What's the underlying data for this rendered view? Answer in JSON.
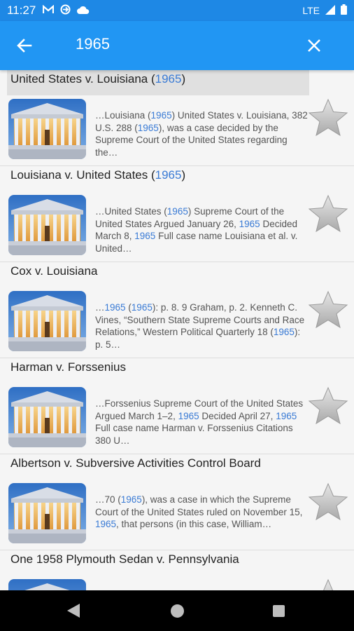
{
  "status_bar": {
    "time": "11:27",
    "icons": [
      "gmail-icon",
      "sync-icon",
      "cloud-icon"
    ],
    "network": "LTE"
  },
  "app_bar": {
    "search_value": "1965",
    "back_icon": "arrow-back-icon",
    "close_icon": "close-icon"
  },
  "colors": {
    "status_bar": "#1e88e5",
    "app_bar": "#2196f3",
    "link": "#3a7bd5"
  },
  "results": [
    {
      "title_pre": "United States v. Louisiana (",
      "title_year": "1965",
      "title_post": ")",
      "highlight": true,
      "snippet": [
        {
          "t": "…Louisiana ("
        },
        {
          "t": "1965",
          "y": true
        },
        {
          "t": ") United States v. Louisiana, 382 U.S. 288 ("
        },
        {
          "t": "1965",
          "y": true
        },
        {
          "t": "), was a case decided by the Supreme Court of the United States regarding the…"
        }
      ]
    },
    {
      "title_pre": "Louisiana v. United States (",
      "title_year": "1965",
      "title_post": ")",
      "highlight": false,
      "snippet": [
        {
          "t": "…United States ("
        },
        {
          "t": "1965",
          "y": true
        },
        {
          "t": ") Supreme Court of the United States Argued January 26, "
        },
        {
          "t": "1965",
          "y": true
        },
        {
          "t": " Decided March 8, "
        },
        {
          "t": "1965",
          "y": true
        },
        {
          "t": " Full case name Louisiana et al. v. United…"
        }
      ]
    },
    {
      "title_pre": "Cox v. Louisiana",
      "title_year": "",
      "title_post": "",
      "highlight": false,
      "snippet": [
        {
          "t": "…"
        },
        {
          "t": "1965",
          "y": true
        },
        {
          "t": " ("
        },
        {
          "t": "1965",
          "y": true
        },
        {
          "t": "): p. 8. 9 Graham, p. 2. Kenneth C. Vines, “Southern State Supreme Courts and Race Relations,” Western Political Quarterly 18 ("
        },
        {
          "t": "1965",
          "y": true
        },
        {
          "t": "): p. 5…"
        }
      ]
    },
    {
      "title_pre": "Harman v. Forssenius",
      "title_year": "",
      "title_post": "",
      "highlight": false,
      "snippet": [
        {
          "t": "…Forssenius Supreme Court of the United States Argued March 1–2, "
        },
        {
          "t": "1965",
          "y": true
        },
        {
          "t": " Decided April 27, "
        },
        {
          "t": "1965",
          "y": true
        },
        {
          "t": " Full case name Harman v. Forssenius Citations 380 U…"
        }
      ]
    },
    {
      "title_pre": "Albertson v. Subversive Activities Control Board",
      "title_year": "",
      "title_post": "",
      "highlight": false,
      "snippet": [
        {
          "t": "…70 ("
        },
        {
          "t": "1965",
          "y": true
        },
        {
          "t": "), was a case in which the Supreme Court of the United States ruled on November 15, "
        },
        {
          "t": "1965",
          "y": true
        },
        {
          "t": ", that persons (in this case, William…"
        }
      ]
    },
    {
      "title_pre": "One 1958 Plymouth Sedan v. Pennsylvania",
      "title_year": "",
      "title_post": "",
      "highlight": false,
      "snippet": []
    }
  ],
  "nav_bar": {
    "icons": [
      "nav-back-icon",
      "nav-home-icon",
      "nav-recents-icon"
    ]
  }
}
